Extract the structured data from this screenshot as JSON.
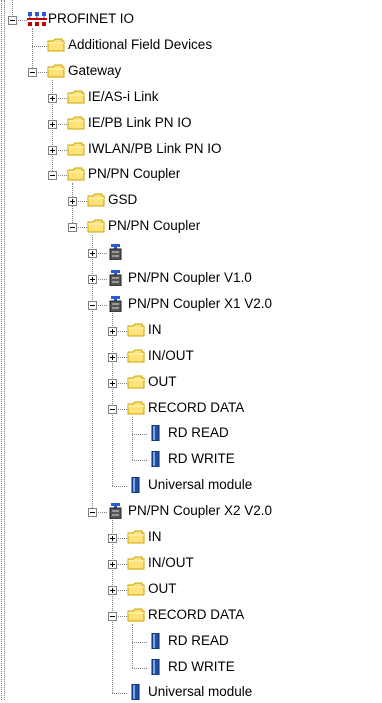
{
  "tree": {
    "items": [
      {
        "label": "PROFINET IO",
        "icon": "network-icon",
        "depth": 0,
        "expander": "minus"
      },
      {
        "label": "Additional Field Devices",
        "icon": "folder-icon",
        "depth": 1,
        "expander": "none"
      },
      {
        "label": "Gateway",
        "icon": "folder-icon",
        "depth": 1,
        "expander": "minus"
      },
      {
        "label": "IE/AS-i Link",
        "icon": "folder-icon",
        "depth": 2,
        "expander": "plus"
      },
      {
        "label": "IE/PB Link PN IO",
        "icon": "folder-icon",
        "depth": 2,
        "expander": "plus"
      },
      {
        "label": "IWLAN/PB Link PN IO",
        "icon": "folder-icon",
        "depth": 2,
        "expander": "plus"
      },
      {
        "label": "PN/PN Coupler",
        "icon": "folder-icon",
        "depth": 2,
        "expander": "minus"
      },
      {
        "label": "GSD",
        "icon": "folder-icon",
        "depth": 3,
        "expander": "plus"
      },
      {
        "label": "PN/PN Coupler",
        "icon": "folder-icon",
        "depth": 3,
        "expander": "minus"
      },
      {
        "label": "",
        "icon": "device-icon",
        "depth": 4,
        "expander": "plus"
      },
      {
        "label": "PN/PN Coupler V1.0",
        "icon": "device-icon",
        "depth": 4,
        "expander": "plus"
      },
      {
        "label": "PN/PN Coupler X1 V2.0",
        "icon": "device-icon",
        "depth": 4,
        "expander": "minus"
      },
      {
        "label": "IN",
        "icon": "folder-icon",
        "depth": 5,
        "expander": "plus"
      },
      {
        "label": "IN/OUT",
        "icon": "folder-icon",
        "depth": 5,
        "expander": "plus"
      },
      {
        "label": "OUT",
        "icon": "folder-icon",
        "depth": 5,
        "expander": "plus"
      },
      {
        "label": "RECORD DATA",
        "icon": "folder-icon",
        "depth": 5,
        "expander": "minus"
      },
      {
        "label": "RD READ",
        "icon": "module-icon",
        "depth": 6,
        "expander": "none"
      },
      {
        "label": "RD WRITE",
        "icon": "module-icon",
        "depth": 6,
        "expander": "none"
      },
      {
        "label": "Universal module",
        "icon": "module-icon",
        "depth": 5,
        "expander": "none"
      },
      {
        "label": "PN/PN Coupler X2 V2.0",
        "icon": "device-icon",
        "depth": 4,
        "expander": "minus"
      },
      {
        "label": "IN",
        "icon": "folder-icon",
        "depth": 5,
        "expander": "plus"
      },
      {
        "label": "IN/OUT",
        "icon": "folder-icon",
        "depth": 5,
        "expander": "plus"
      },
      {
        "label": "OUT",
        "icon": "folder-icon",
        "depth": 5,
        "expander": "plus"
      },
      {
        "label": "RECORD DATA",
        "icon": "folder-icon",
        "depth": 5,
        "expander": "minus"
      },
      {
        "label": "RD READ",
        "icon": "module-icon",
        "depth": 6,
        "expander": "none"
      },
      {
        "label": "RD WRITE",
        "icon": "module-icon",
        "depth": 6,
        "expander": "none"
      },
      {
        "label": "Universal module",
        "icon": "module-icon",
        "depth": 5,
        "expander": "none"
      }
    ]
  },
  "colors": {
    "folder": "#ffe27a",
    "folder_dark": "#c8a400",
    "module": "#1f4ea3",
    "device_top": "#2b5bd0",
    "device_body": "#555555"
  }
}
